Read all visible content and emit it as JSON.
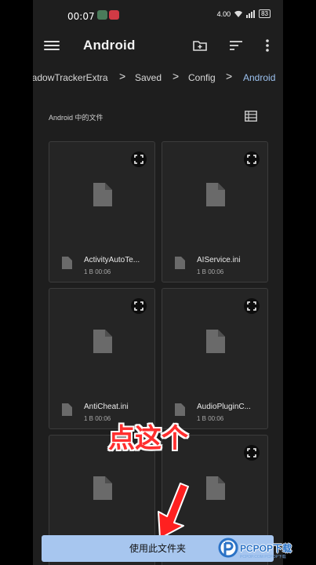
{
  "status": {
    "time": "00:07",
    "net_speed": "4.00",
    "battery": "83"
  },
  "appbar": {
    "title": "Android"
  },
  "breadcrumb": {
    "items": [
      "hadowTrackerExtra",
      "Saved",
      "Config",
      "Android"
    ],
    "separator": ">"
  },
  "section": {
    "label": "Android 中的文件"
  },
  "files": [
    {
      "name": "ActivityAutoTe...",
      "meta": "1 B 00:06"
    },
    {
      "name": "AIService.ini",
      "meta": "1 B 00:06"
    },
    {
      "name": "AntiCheat.ini",
      "meta": "1 B 00:06"
    },
    {
      "name": "AudioPluginC...",
      "meta": "1 B 00:06"
    },
    {
      "name": "",
      "meta": ""
    },
    {
      "name": "",
      "meta": ""
    }
  ],
  "annotation": {
    "text": "点这个"
  },
  "bottom": {
    "use_folder_label": "使用此文件夹"
  },
  "watermark": {
    "text": "PCPOP下载",
    "sub": "PCPOP.COM PCPOP下载"
  },
  "colors": {
    "accent": "#9cc2f0",
    "button": "#a7c6ef",
    "annotation": "#ff2f2f"
  }
}
